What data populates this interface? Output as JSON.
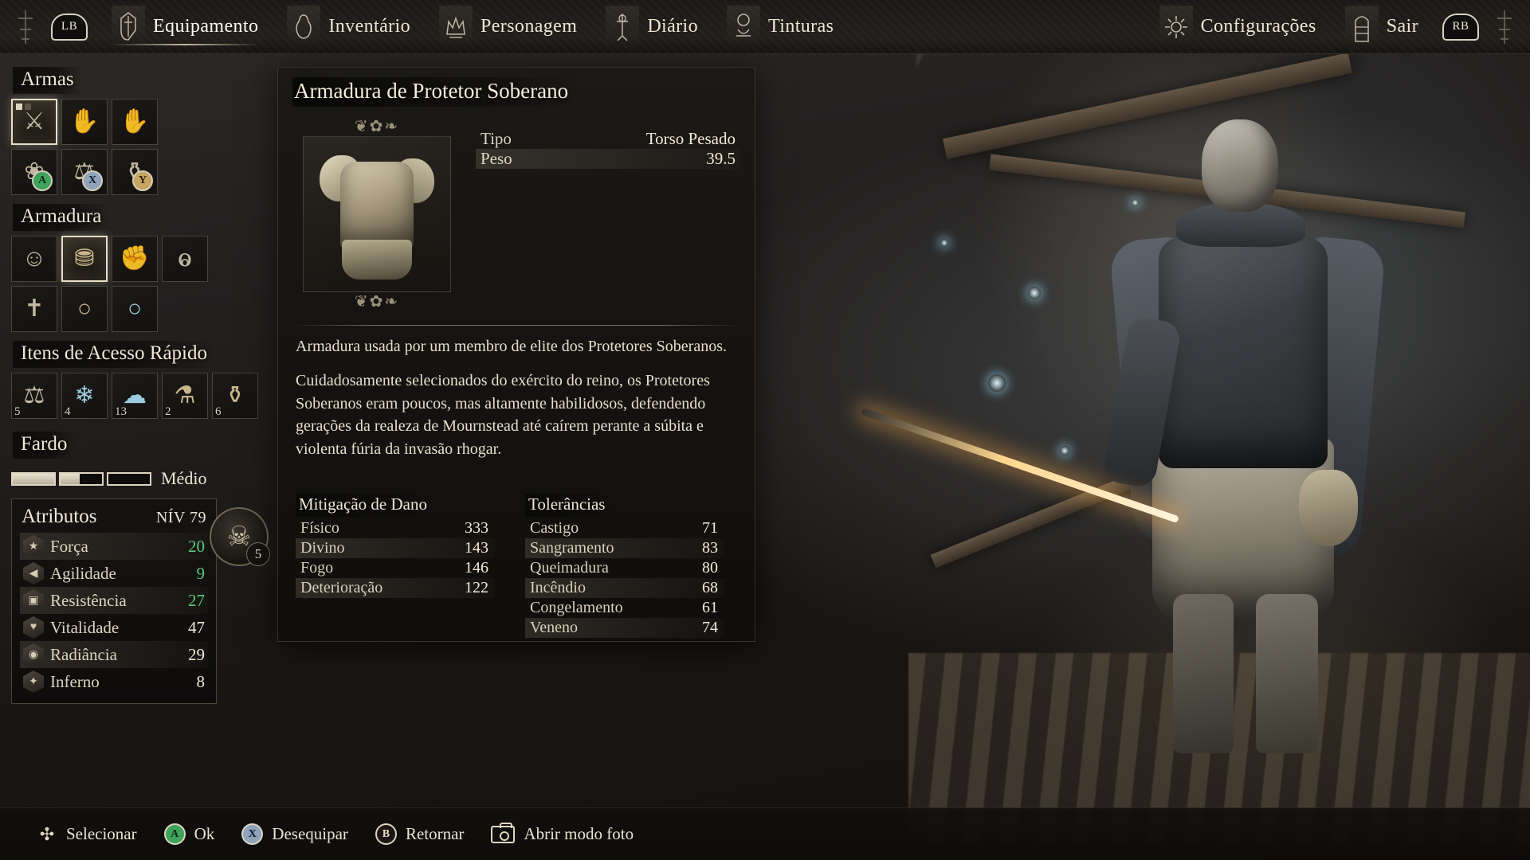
{
  "topnav": {
    "left_bumper": "LB",
    "right_bumper": "RB",
    "items": [
      {
        "label": "Equipamento",
        "icon": "sword-shield-icon",
        "active": true
      },
      {
        "label": "Inventário",
        "icon": "pouch-icon",
        "active": false
      },
      {
        "label": "Personagem",
        "icon": "crown-icon",
        "active": false
      },
      {
        "label": "Diário",
        "icon": "quill-icon",
        "active": false
      },
      {
        "label": "Tinturas",
        "icon": "flask-icon",
        "active": false
      }
    ],
    "right_items": [
      {
        "label": "Configurações",
        "icon": "gear-icon"
      },
      {
        "label": "Sair",
        "icon": "door-icon"
      }
    ]
  },
  "sidebar": {
    "sections": [
      {
        "title": "Armas",
        "rows": [
          [
            {
              "name": "weapon-slot-primary",
              "glyph": "⚔",
              "selected": true,
              "toggles": [
                true,
                false
              ]
            },
            {
              "name": "weapon-slot-offhand-empty",
              "glyph": "✋",
              "dim": true
            },
            {
              "name": "weapon-slot-offhand",
              "glyph": "Ὑ0"
            }
          ],
          [
            {
              "name": "spell-slot-1",
              "glyph": "❀",
              "badge": "A",
              "badge_kind": "a"
            },
            {
              "name": "spell-slot-2",
              "glyph": "⚒",
              "badge": "X",
              "badge_kind": "x"
            },
            {
              "name": "spell-slot-3",
              "glyph": "⚱",
              "badge": "Y",
              "badge_kind": "y"
            }
          ]
        ]
      },
      {
        "title": "Armadura",
        "rows": [
          [
            {
              "name": "armor-slot-head",
              "glyph": "☺"
            },
            {
              "name": "armor-slot-torso",
              "glyph": "⛊",
              "selected": true
            },
            {
              "name": "armor-slot-arms",
              "glyph": "✊"
            },
            {
              "name": "armor-slot-legs",
              "glyph": "ⱺ"
            }
          ],
          [
            {
              "name": "amulet-slot",
              "glyph": "✝"
            },
            {
              "name": "ring-slot-1",
              "glyph": "○",
              "gold": true
            },
            {
              "name": "ring-slot-2",
              "glyph": "○",
              "ice": true
            }
          ]
        ]
      },
      {
        "title": "Itens de Acesso Rápido",
        "rows": [
          [
            {
              "name": "quick-slot-1",
              "glyph": "⚒",
              "qty": "5"
            },
            {
              "name": "quick-slot-2",
              "glyph": "❄",
              "qty": "4",
              "ice": true
            },
            {
              "name": "quick-slot-3",
              "glyph": "☁",
              "qty": "13",
              "ice": true
            },
            {
              "name": "quick-slot-4",
              "glyph": "⚗",
              "qty": "2",
              "gold": true
            },
            {
              "name": "quick-slot-5",
              "glyph": "⚱",
              "qty": "6",
              "gold": true
            }
          ]
        ]
      }
    ],
    "burden": {
      "title": "Fardo",
      "level_label": "Médio",
      "segments": [
        100,
        46,
        0
      ]
    },
    "attributes": {
      "title": "Atributos",
      "level_label": "NÍV 79",
      "vigor_badge": "5",
      "rows": [
        {
          "name": "Força",
          "value": "20",
          "icon": "strength-icon",
          "buffed": true
        },
        {
          "name": "Agilidade",
          "value": "9",
          "icon": "agility-icon",
          "buffed": true
        },
        {
          "name": "Resistência",
          "value": "27",
          "icon": "endurance-icon",
          "buffed": true
        },
        {
          "name": "Vitalidade",
          "value": "47",
          "icon": "vitality-icon",
          "buffed": false
        },
        {
          "name": "Radiância",
          "value": "29",
          "icon": "radiance-icon",
          "buffed": false
        },
        {
          "name": "Inferno",
          "value": "8",
          "icon": "inferno-icon",
          "buffed": false
        }
      ]
    }
  },
  "detail": {
    "title": "Armadura de Protetor Soberano",
    "stats": [
      {
        "label": "Tipo",
        "value": "Torso Pesado"
      },
      {
        "label": "Peso",
        "value": "39.5"
      }
    ],
    "description_1": "Armadura usada por um membro de elite dos Protetores Soberanos.",
    "description_2": "Cuidadosamente selecionados do exército do reino, os Protetores Soberanos eram poucos, mas altamente habilidosos, defendendo gerações da realeza de Mournstead até caírem perante a súbita e violenta fúria da invasão rhogar.",
    "mitigation": {
      "title": "Mitigação de Dano",
      "rows": [
        {
          "label": "Físico",
          "value": "333"
        },
        {
          "label": "Divino",
          "value": "143"
        },
        {
          "label": "Fogo",
          "value": "146"
        },
        {
          "label": "Deterioração",
          "value": "122"
        }
      ]
    },
    "tolerances": {
      "title": "Tolerâncias",
      "rows": [
        {
          "label": "Castigo",
          "value": "71"
        },
        {
          "label": "Sangramento",
          "value": "83"
        },
        {
          "label": "Queimadura",
          "value": "80"
        },
        {
          "label": "Incêndio",
          "value": "68"
        },
        {
          "label": "Congelamento",
          "value": "61"
        },
        {
          "label": "Veneno",
          "value": "74"
        }
      ]
    }
  },
  "footer": {
    "items": [
      {
        "label": "Selecionar",
        "button": "dpad",
        "glyph": "✣"
      },
      {
        "label": "Ok",
        "button": "a",
        "glyph": "A"
      },
      {
        "label": "Desequipar",
        "button": "x",
        "glyph": "X"
      },
      {
        "label": "Retornar",
        "button": "b",
        "glyph": "B"
      },
      {
        "label": "Abrir modo foto",
        "button": "camera",
        "glyph": ""
      }
    ]
  },
  "colors": {
    "accent": "#e6ddc6",
    "buff_green": "#5ec77f",
    "panel_bg": "#16140f"
  }
}
